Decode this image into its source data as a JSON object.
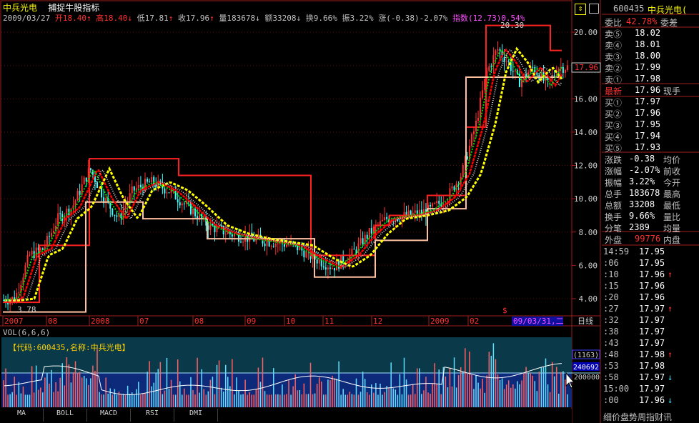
{
  "header": {
    "stock_name": "中兵光电",
    "indicator_name": "捕捉牛股指标"
  },
  "quote": {
    "date": "2009/03/27",
    "open": "开18.40",
    "high": "高18.40",
    "low": "低17.81",
    "close": "收17.96",
    "volume": "量183678",
    "amount": "额33208",
    "turnover": "换9.66%",
    "amplitude": "振3.22%",
    "change": "涨(-0.38)-2.07%",
    "index": "指数(12.73)0.54%",
    "arrow_up": "↑",
    "arrow_down": "↓"
  },
  "main_chart": {
    "y_ticks": [
      "20.00",
      "18.00",
      "16.00",
      "14.00",
      "12.00",
      "10.00",
      "8.00",
      "6.00",
      "4.00"
    ],
    "y_values": [
      20,
      18,
      16,
      14,
      12,
      10,
      8,
      6,
      4
    ],
    "high_marker": "20.30",
    "low_marker": "3.78",
    "last_price_tag": "17.96",
    "dollar_marker": "$",
    "x_labels": [
      "2007",
      "08",
      "2008",
      "07",
      "08",
      "09",
      "10",
      "11",
      "12",
      "2009",
      "02"
    ],
    "date_tag": "09/03/31,二",
    "period": "日线",
    "colors": {
      "up": "#ff3030",
      "down": "#00ffff",
      "ma_red": "#ff0000",
      "ma_yellow": "#ffff00",
      "ma_green": "#00dd00",
      "ma_white": "#d0d0d0",
      "channel_upper": "#ff2020",
      "channel_lower": "#ffc0a0"
    }
  },
  "vol_panel": {
    "label": "VOL(6,6,6)",
    "info": "【代码:600435,名称:中兵光电】",
    "tag_top": "(1163)",
    "tag_value": "240692",
    "tag_axis": "200000"
  },
  "tabs": [
    "MA",
    "BOLL",
    "MACD",
    "RSI",
    "DMI"
  ],
  "right_panel": {
    "code": "600435",
    "name": "中兵光电(",
    "weibi_label": "委比",
    "weibi_value": "42.78%",
    "weicha_label": "委差",
    "sell": [
      {
        "label": "卖⑤",
        "price": "18.02"
      },
      {
        "label": "卖④",
        "price": "18.01"
      },
      {
        "label": "卖③",
        "price": "18.00"
      },
      {
        "label": "卖②",
        "price": "17.99"
      },
      {
        "label": "卖①",
        "price": "17.98"
      }
    ],
    "latest_label": "最新",
    "latest_value": "17.96",
    "xianshou_label": "现手",
    "buy": [
      {
        "label": "买①",
        "price": "17.97"
      },
      {
        "label": "买②",
        "price": "17.96"
      },
      {
        "label": "买③",
        "price": "17.95"
      },
      {
        "label": "买④",
        "price": "17.94"
      },
      {
        "label": "买⑤",
        "price": "17.93"
      }
    ],
    "stats": [
      {
        "k1": "涨跌",
        "v1": " -0.38",
        "k2": "均价"
      },
      {
        "k1": "涨幅",
        "v1": "-2.07%",
        "k2": "前收"
      },
      {
        "k1": "振幅",
        "v1": " 3.22%",
        "k2": "今开"
      },
      {
        "k1": "总手",
        "v1": "183678",
        "k2": "最高"
      },
      {
        "k1": "总额",
        "v1": " 33208",
        "k2": "最低"
      },
      {
        "k1": "换手",
        "v1": " 9.66%",
        "k2": "量比"
      },
      {
        "k1": "分笔",
        "v1": "  2389",
        "k2": "均量"
      }
    ],
    "outer_label": "外盘",
    "outer_value": "99776",
    "inner_label": "内盘",
    "ticks": [
      {
        "t": "14:59",
        "p": "17.95",
        "a": ""
      },
      {
        "t": "   :06",
        "p": "17.95",
        "a": ""
      },
      {
        "t": "   :10",
        "p": "17.96",
        "a": "↑"
      },
      {
        "t": "   :15",
        "p": "17.96",
        "a": ""
      },
      {
        "t": "   :20",
        "p": "17.96",
        "a": ""
      },
      {
        "t": "   :27",
        "p": "17.97",
        "a": "↑"
      },
      {
        "t": "   :32",
        "p": "17.97",
        "a": ""
      },
      {
        "t": "   :38",
        "p": "17.97",
        "a": ""
      },
      {
        "t": "   :43",
        "p": "17.97",
        "a": ""
      },
      {
        "t": "   :48",
        "p": "17.98",
        "a": "↑"
      },
      {
        "t": "   :53",
        "p": "17.98",
        "a": ""
      },
      {
        "t": "   :58",
        "p": "17.97",
        "a": "↓"
      },
      {
        "t": "15:00",
        "p": "17.97",
        "a": ""
      },
      {
        "t": "   :00",
        "p": "17.96",
        "a": "↓"
      }
    ],
    "footer": "细价盘势周指财讯"
  }
}
